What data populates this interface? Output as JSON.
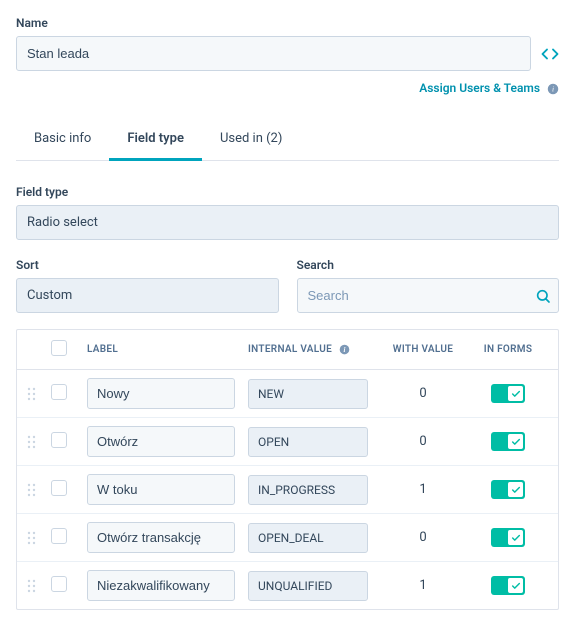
{
  "name_label": "Name",
  "name_value": "Stan leada",
  "assign_link": "Assign Users & Teams",
  "tabs": [
    {
      "label": "Basic info",
      "active": false
    },
    {
      "label": "Field type",
      "active": true
    },
    {
      "label": "Used in (2)",
      "active": false
    }
  ],
  "field_type_label": "Field type",
  "field_type_value": "Radio select",
  "sort_label": "Sort",
  "sort_value": "Custom",
  "search_label": "Search",
  "search_placeholder": "Search",
  "columns": {
    "label": "LABEL",
    "internal": "INTERNAL VALUE",
    "with_value": "WITH VALUE",
    "in_forms": "IN FORMS"
  },
  "rows": [
    {
      "label": "Nowy",
      "internal": "NEW",
      "with_value": "0",
      "in_forms": true
    },
    {
      "label": "Otwórz",
      "internal": "OPEN",
      "with_value": "0",
      "in_forms": true
    },
    {
      "label": "W toku",
      "internal": "IN_PROGRESS",
      "with_value": "1",
      "in_forms": true
    },
    {
      "label": "Otwórz transakcję",
      "internal": "OPEN_DEAL",
      "with_value": "0",
      "in_forms": true
    },
    {
      "label": "Niezakwalifikowany",
      "internal": "UNQUALIFIED",
      "with_value": "1",
      "in_forms": true
    }
  ]
}
